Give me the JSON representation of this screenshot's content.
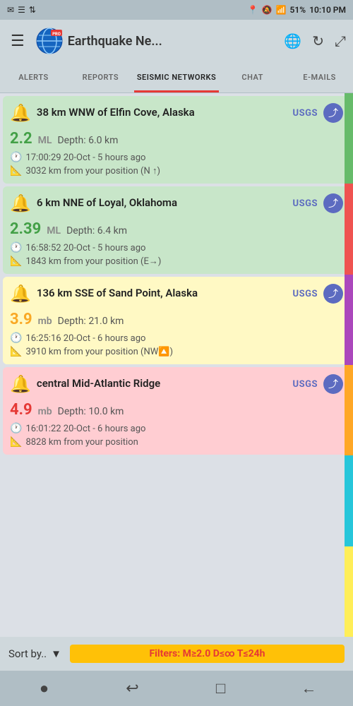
{
  "statusBar": {
    "leftIcons": [
      "✉",
      "☰",
      "↕"
    ],
    "battery": "51%",
    "time": "10:10 PM",
    "signal": "WiFi"
  },
  "topBar": {
    "menuIcon": "☰",
    "appTitle": "Earthquake Ne...",
    "globeIcon": "🌐",
    "refreshIcon": "↻",
    "expandIcon": "⤢"
  },
  "tabs": [
    {
      "id": "alerts",
      "label": "ALERTS",
      "active": false
    },
    {
      "id": "reports",
      "label": "REPORTS",
      "active": false
    },
    {
      "id": "seismic",
      "label": "SEISMIC NETWORKS",
      "active": true
    },
    {
      "id": "chat",
      "label": "CHAT",
      "active": false
    },
    {
      "id": "emails",
      "label": "E-MAILS",
      "active": false
    }
  ],
  "earthquakes": [
    {
      "id": "eq1",
      "cardColor": "green",
      "location": "38 km WNW of Elfin Cove, Alaska",
      "source": "USGS",
      "magnitude": "2.2",
      "magType": "ML",
      "depth": "6.0 km",
      "time": "17:00:29 20-Oct - 5 hours ago",
      "distance": "3032 km from your position (N ↑)"
    },
    {
      "id": "eq2",
      "cardColor": "green",
      "location": "6 km NNE of Loyal, Oklahoma",
      "source": "USGS",
      "magnitude": "2.39",
      "magType": "ML",
      "depth": "6.4 km",
      "time": "16:58:52 20-Oct - 5 hours ago",
      "distance": "1843 km from your position (E→)"
    },
    {
      "id": "eq3",
      "cardColor": "yellow",
      "location": "136 km SSE of Sand Point, Alaska",
      "source": "USGS",
      "magnitude": "3.9",
      "magType": "mb",
      "depth": "21.0 km",
      "time": "16:25:16 20-Oct - 6 hours ago",
      "distance": "3910 km from your position (NW🔼)"
    },
    {
      "id": "eq4",
      "cardColor": "pink",
      "location": "central Mid-Atlantic Ridge",
      "source": "USGS",
      "magnitude": "4.9",
      "magType": "mb",
      "depth": "10.0 km",
      "time": "16:01:22 20-Oct - 6 hours ago",
      "distance": "8828 km from your position"
    }
  ],
  "sortBar": {
    "label": "Sort by..",
    "chevron": "▼"
  },
  "filterBadge": {
    "prefix": "Filters: M≥",
    "magnitude": "2.0",
    "suffix": " D≤∞ T≤24h"
  },
  "bottomNav": [
    {
      "id": "dot",
      "icon": "●"
    },
    {
      "id": "back-arrow",
      "icon": "↩"
    },
    {
      "id": "square",
      "icon": "□"
    },
    {
      "id": "return",
      "icon": "←"
    }
  ]
}
